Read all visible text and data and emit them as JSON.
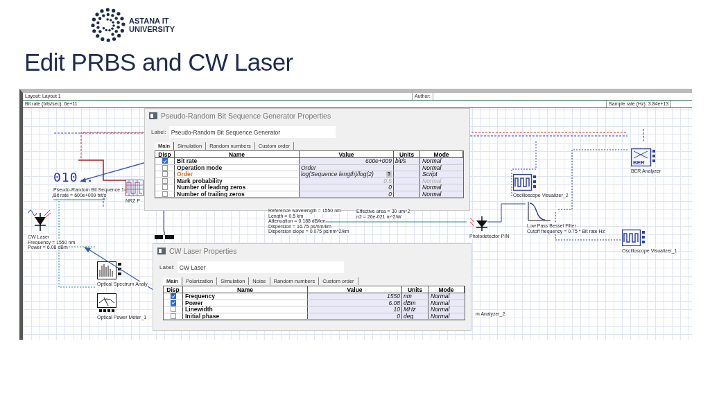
{
  "logo": {
    "lines": [
      "ASTANA IT",
      "UNIVERSITY"
    ]
  },
  "title": "Edit PRBS and CW Laser",
  "layout_bar": {
    "layout": "Layout: Layout 1",
    "author": "Author:",
    "bit_rate": "Bit rate (bits/sec):  6e+11",
    "sample_rate": "Sample rate (Hz):  3.84e+13"
  },
  "nodes": [
    {
      "kind": "prbs",
      "icon_text": "010..",
      "lines": [
        "Pseudo-Random Bit Sequence 1",
        "Bit rate = 600e+009  bit/s"
      ]
    },
    {
      "kind": "nrz",
      "lines": [
        "NRZ P"
      ]
    },
    {
      "kind": "cw_laser",
      "lines": [
        "CW Laser",
        "Frequency = 1550  nm",
        "Power = 6.08  dBm"
      ]
    },
    {
      "kind": "spectrum_analyzer",
      "lines": [
        "Optical Spectrum Analy"
      ]
    },
    {
      "kind": "power_meter",
      "lines": [
        "Optical Power Meter_1"
      ]
    },
    {
      "kind": "label",
      "lines": [
        "Reference wavelength = 1550  nm",
        "Length = 0.5  km",
        "Attenuation = 0.188  dB/km",
        "Dispersion = 16.75  ps/nm/km",
        "Dispersion slope = 0.075  ps/nm^2/km"
      ]
    },
    {
      "kind": "label",
      "lines": [
        "Effective area = 30  um^2",
        "n2 = 26e-021  m^2/W"
      ]
    },
    {
      "kind": "photodetector",
      "lines": [
        "Photodetector PIN"
      ]
    },
    {
      "kind": "filter",
      "lines": [
        "Low Pass Bessel Filter",
        "Cutoff frequency = 0.75 * Bit rate  Hz"
      ]
    },
    {
      "kind": "oscilloscope",
      "lines": [
        "Oscilloscope Visualizer_2"
      ]
    },
    {
      "kind": "ber",
      "icon_text": "BER",
      "lines": [
        "BER Analyzer"
      ]
    },
    {
      "kind": "oscilloscope",
      "lines": [
        "Oscilloscope Visualizer_1"
      ]
    },
    {
      "kind": "label",
      "lines": [
        "m Analyzer_2"
      ]
    },
    {
      "kind": "block"
    }
  ],
  "dialogs": [
    {
      "title": "Pseudo-Random Bit Sequence Generator Properties",
      "label_caption": "Label:",
      "label_value": "Pseudo-Random Bit Sequence Generator",
      "tabs": [
        {
          "label": "Main",
          "selected": true
        },
        {
          "label": "Simulation",
          "selected": false
        },
        {
          "label": "Random numbers",
          "selected": false
        },
        {
          "label": "Custom order",
          "selected": false
        }
      ],
      "columns": [
        "Disp",
        "Name",
        "Value",
        "Units",
        "Mode"
      ],
      "rows": [
        {
          "disp": true,
          "name": "Bit rate",
          "kind": "number",
          "value": "600e+009",
          "units": "bit/s",
          "mode": "Normal",
          "disabled": false
        },
        {
          "disp": false,
          "name": "Operation mode",
          "kind": "choice",
          "value": "Order",
          "mode": "Normal",
          "disabled": false
        },
        {
          "disp": false,
          "name": "Order",
          "kind": "script",
          "value": "log(Sequence length)/log(2)",
          "value_button": "5",
          "mode": "Script",
          "disabled": false
        },
        {
          "disp": false,
          "name": "Mark probability",
          "kind": "number",
          "value": "0.5",
          "mode": "Normal",
          "disabled": true
        },
        {
          "disp": false,
          "name": "Number of leading zeros",
          "kind": "number",
          "value": "0",
          "mode": "Normal",
          "disabled": false
        },
        {
          "disp": false,
          "name": "Number of trailing zeros",
          "kind": "number",
          "value": "0",
          "mode": "Normal",
          "disabled": false
        }
      ]
    },
    {
      "title": "CW Laser Properties",
      "label_caption": "Label:",
      "label_value": "CW Laser",
      "tabs": [
        {
          "label": "Main",
          "selected": true
        },
        {
          "label": "Polarization",
          "selected": false
        },
        {
          "label": "Simulation",
          "selected": false
        },
        {
          "label": "Noise",
          "selected": false
        },
        {
          "label": "Random numbers",
          "selected": false
        },
        {
          "label": "Custom order",
          "selected": false
        }
      ],
      "columns": [
        "Disp",
        "Name",
        "Value",
        "Units",
        "Mode"
      ],
      "rows": [
        {
          "disp": true,
          "name": "Frequency",
          "kind": "number",
          "value": "1550",
          "units": "nm",
          "mode": "Normal",
          "disabled": false
        },
        {
          "disp": true,
          "name": "Power",
          "kind": "number",
          "value": "6.08",
          "units": "dBm",
          "mode": "Normal",
          "disabled": false
        },
        {
          "disp": false,
          "name": "Linewidth",
          "kind": "number",
          "value": "10",
          "units": "MHz",
          "mode": "Normal",
          "disabled": false
        },
        {
          "disp": false,
          "name": "Initial phase",
          "kind": "number",
          "value": "0",
          "units": "deg",
          "mode": "Normal",
          "disabled": false
        }
      ]
    }
  ]
}
